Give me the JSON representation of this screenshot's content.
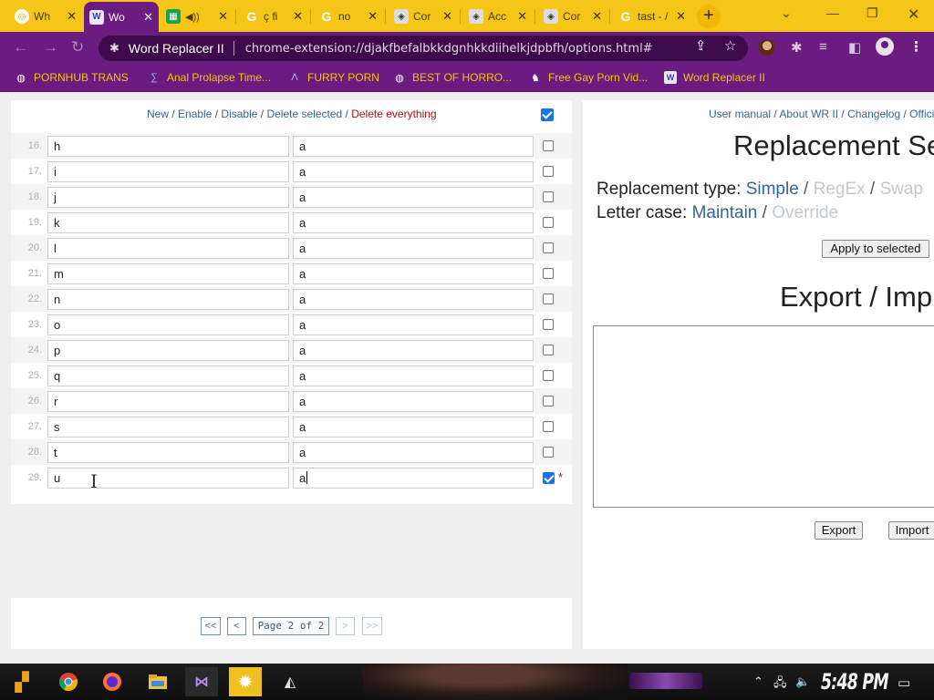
{
  "browser": {
    "tabs": [
      {
        "title": "Wh",
        "icon": "chrome-icon",
        "active": false
      },
      {
        "title": "Wo",
        "icon": "word-replacer-icon",
        "active": true
      },
      {
        "title": "",
        "icon": "sheets-icon",
        "audio": true,
        "active": false
      },
      {
        "title": "ç fi",
        "icon": "google-icon",
        "active": false
      },
      {
        "title": "no",
        "icon": "google-icon",
        "active": false
      },
      {
        "title": "Cor",
        "icon": "extension-icon",
        "active": false
      },
      {
        "title": "Acc",
        "icon": "extension-icon",
        "active": false
      },
      {
        "title": "Cor",
        "icon": "extension-icon",
        "active": false
      },
      {
        "title": "tast - /",
        "icon": "google-icon",
        "active": false
      }
    ],
    "new_tab": "+",
    "site_name": "Word Replacer II",
    "url": "chrome-extension://djakfbefalbkkdgnhkkdiihelkjdpbfh/options.html#",
    "bookmarks": [
      {
        "label": "PORNHUB TRANS",
        "icon": "globe-icon"
      },
      {
        "label": "Anal Prolapse Time...",
        "icon": "bookmark-icon"
      },
      {
        "label": "FURRY PORN",
        "icon": "bookmark-icon"
      },
      {
        "label": "BEST OF HORRO...",
        "icon": "globe-icon"
      },
      {
        "label": "Free Gay Porn Vid...",
        "icon": "bookmark-icon"
      },
      {
        "label": "Word Replacer II",
        "icon": "word-replacer-icon"
      }
    ]
  },
  "list": {
    "actions": {
      "new": "New",
      "enable": "Enable",
      "disable": "Disable",
      "delete_selected": "Delete selected",
      "delete_everything": "Delete everything",
      "sep": " / "
    },
    "header_checked": true,
    "rows": [
      {
        "num": "16.",
        "find": "h",
        "replace": "a",
        "checked": false
      },
      {
        "num": "17.",
        "find": "i",
        "replace": "a",
        "checked": false
      },
      {
        "num": "18.",
        "find": "j",
        "replace": "a",
        "checked": false
      },
      {
        "num": "19.",
        "find": "k",
        "replace": "a",
        "checked": false
      },
      {
        "num": "20.",
        "find": "l",
        "replace": "a",
        "checked": false
      },
      {
        "num": "21.",
        "find": "m",
        "replace": "a",
        "checked": false
      },
      {
        "num": "22.",
        "find": "n",
        "replace": "a",
        "checked": false
      },
      {
        "num": "23.",
        "find": "o",
        "replace": "a",
        "checked": false
      },
      {
        "num": "24.",
        "find": "p",
        "replace": "a",
        "checked": false
      },
      {
        "num": "25.",
        "find": "q",
        "replace": "a",
        "checked": false
      },
      {
        "num": "26.",
        "find": "r",
        "replace": "a",
        "checked": false
      },
      {
        "num": "27.",
        "find": "s",
        "replace": "a",
        "checked": false
      },
      {
        "num": "28.",
        "find": "t",
        "replace": "a",
        "checked": false
      },
      {
        "num": "29.",
        "find": "u",
        "replace": "a",
        "checked": true,
        "modified_marker": "*"
      }
    ]
  },
  "pager": {
    "first": "<<",
    "prev": "<",
    "label": "Page 2 of 2",
    "next": ">",
    "last": ">>"
  },
  "settings": {
    "links": {
      "manual": "User manual",
      "about": "About WR II",
      "changelog": "Changelog",
      "official": "Offici",
      "sep": " / "
    },
    "heading": "Replacement Se",
    "type_label": "Replacement type: ",
    "type_simple": "Simple",
    "type_regex": "RegEx",
    "type_swap": "Swap",
    "case_label": "Letter case: ",
    "case_maintain": "Maintain",
    "case_override": "Override",
    "apply_button": "Apply to selected",
    "export_heading": "Export / Imp",
    "export_button": "Export",
    "import_button": "Import"
  },
  "taskbar": {
    "clock": "5:48 PM",
    "apps": [
      "start-icon",
      "chrome-icon",
      "firefox-icon",
      "file-explorer-icon",
      "visual-studio-icon",
      "settings-icon",
      "app-icon"
    ]
  },
  "colors": {
    "tab_strip": "#f5c518",
    "toolbar": "#6b1c80",
    "link": "#336699",
    "danger": "#b01010",
    "checkbox": "#1a73e8"
  }
}
